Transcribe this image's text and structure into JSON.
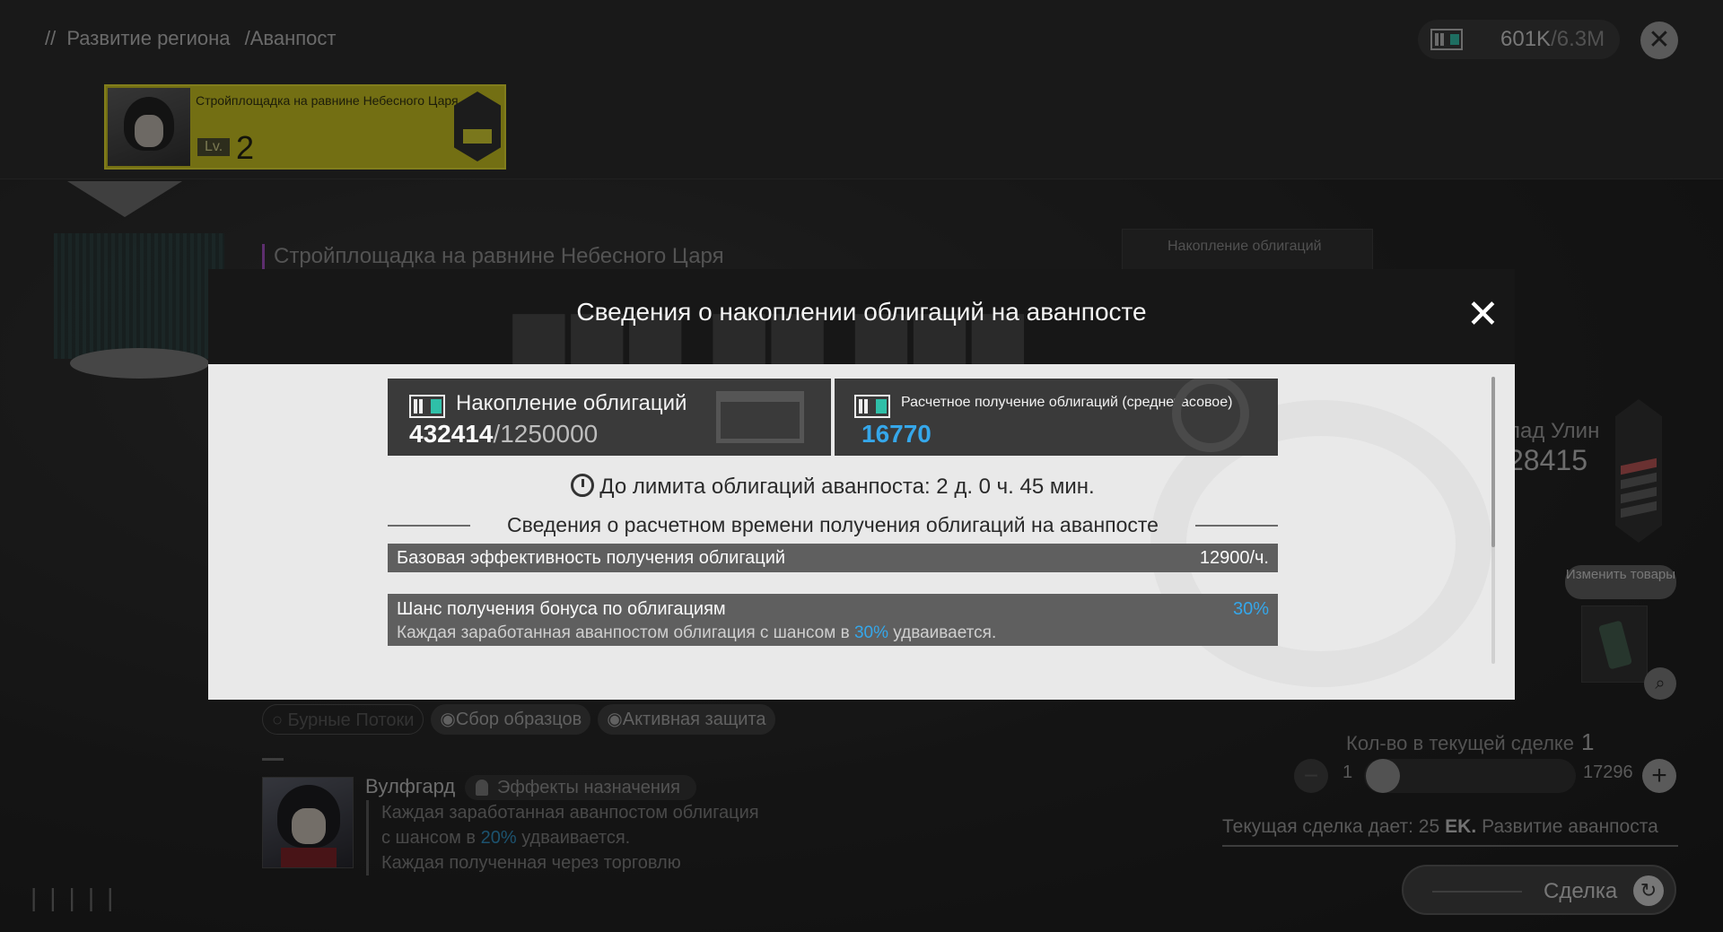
{
  "header": {
    "breadcrumb_region": "Развитие региона",
    "breadcrumb_outpost": "/Аванпост",
    "currency_value": "601K",
    "currency_max": "/6.3M"
  },
  "site": {
    "name": "Стройплощадка на равнине Небесного Царя",
    "level_label": "Lv.",
    "level": "2",
    "subtitle": "Стройплощадка на равнине Небесного Царя",
    "bg_stat_label": "Накопление облигаций"
  },
  "right_panel": {
    "name_partial": "лад Улин",
    "value_partial": "28415",
    "change_goods": "Изменить товары"
  },
  "tags": [
    "Бурные Потоки",
    "Сбор образцов",
    "Активная защита"
  ],
  "character": {
    "name": "Вулфгард",
    "effects_label": "Эффекты назначения",
    "desc_1": "Каждая заработанная аванпостом облигация",
    "desc_2_pre": "с шансом в ",
    "desc_2_hl": "20%",
    "desc_2_post": " удваивается.",
    "desc_3": "Каждая полученная через торговлю"
  },
  "deal": {
    "qty_label": "Кол-во в текущей сделке",
    "qty_value": "1",
    "min": "1",
    "max": "17296",
    "gives_text": "Текущая сделка дает: 25",
    "gives_mark": "EK.",
    "gives_target": "Развитие аванпоста",
    "button_label": "Сделка"
  },
  "modal": {
    "title": "Сведения о накоплении облигаций на аванпосте",
    "accum_label": "Накопление облигаций",
    "accum_value": "432414",
    "accum_max": "/1250000",
    "estimated_label": "Расчетное получение облигаций (среднечасовое)",
    "estimated_value": "16770",
    "limit_text": "До лимита облигаций аванпоста: 2 д. 0 ч. 45 мин.",
    "section_title": "Сведения о расчетном времени получения облигаций на аванпосте",
    "base_label": "Базовая эффективность получения облигаций",
    "base_value": "12900/ч.",
    "bonus_label": "Шанс получения бонуса по облигациям",
    "bonus_value": "30%",
    "bonus_desc_pre": "Каждая заработанная аванпостом облигация с шансом в ",
    "bonus_desc_hl": "30%",
    "bonus_desc_post": " удваивается."
  },
  "colors": {
    "accent_blue": "#35a7ea",
    "site_card_yellow": "#c9c21b"
  }
}
